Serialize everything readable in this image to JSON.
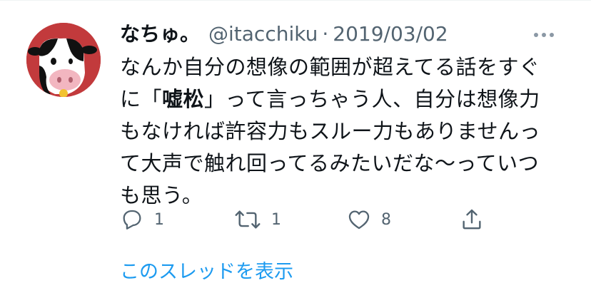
{
  "tweet": {
    "author": {
      "display_name": "なちゅ。",
      "handle": "@itacchiku",
      "avatar": "cow-avatar"
    },
    "separator": "·",
    "date": "2019/03/02",
    "text": {
      "line1": "なんか自分の想像の範囲が超えてる話をすぐ",
      "line2_before": "に「",
      "line2_bold": "嘘松",
      "line2_after": "」って言っちゃう人、自分は想像力",
      "line3": "もなければ許容力もスルー力もありませんっ",
      "line4": "て大声で触れ回ってるみたいだな〜っていつ",
      "line5": "も思う。"
    },
    "actions": {
      "reply": {
        "icon": "reply-icon",
        "count": "1"
      },
      "retweet": {
        "icon": "retweet-icon",
        "count": "1"
      },
      "like": {
        "icon": "like-icon",
        "count": "8"
      },
      "share": {
        "icon": "share-icon"
      }
    },
    "more_icon": "more-options-icon"
  },
  "thread_link": "このスレッドを表示",
  "colors": {
    "link": "#1d9bf0",
    "secondary_text": "#536471",
    "primary_text": "#0f1419",
    "avatar_bg": "#c23a3c"
  }
}
